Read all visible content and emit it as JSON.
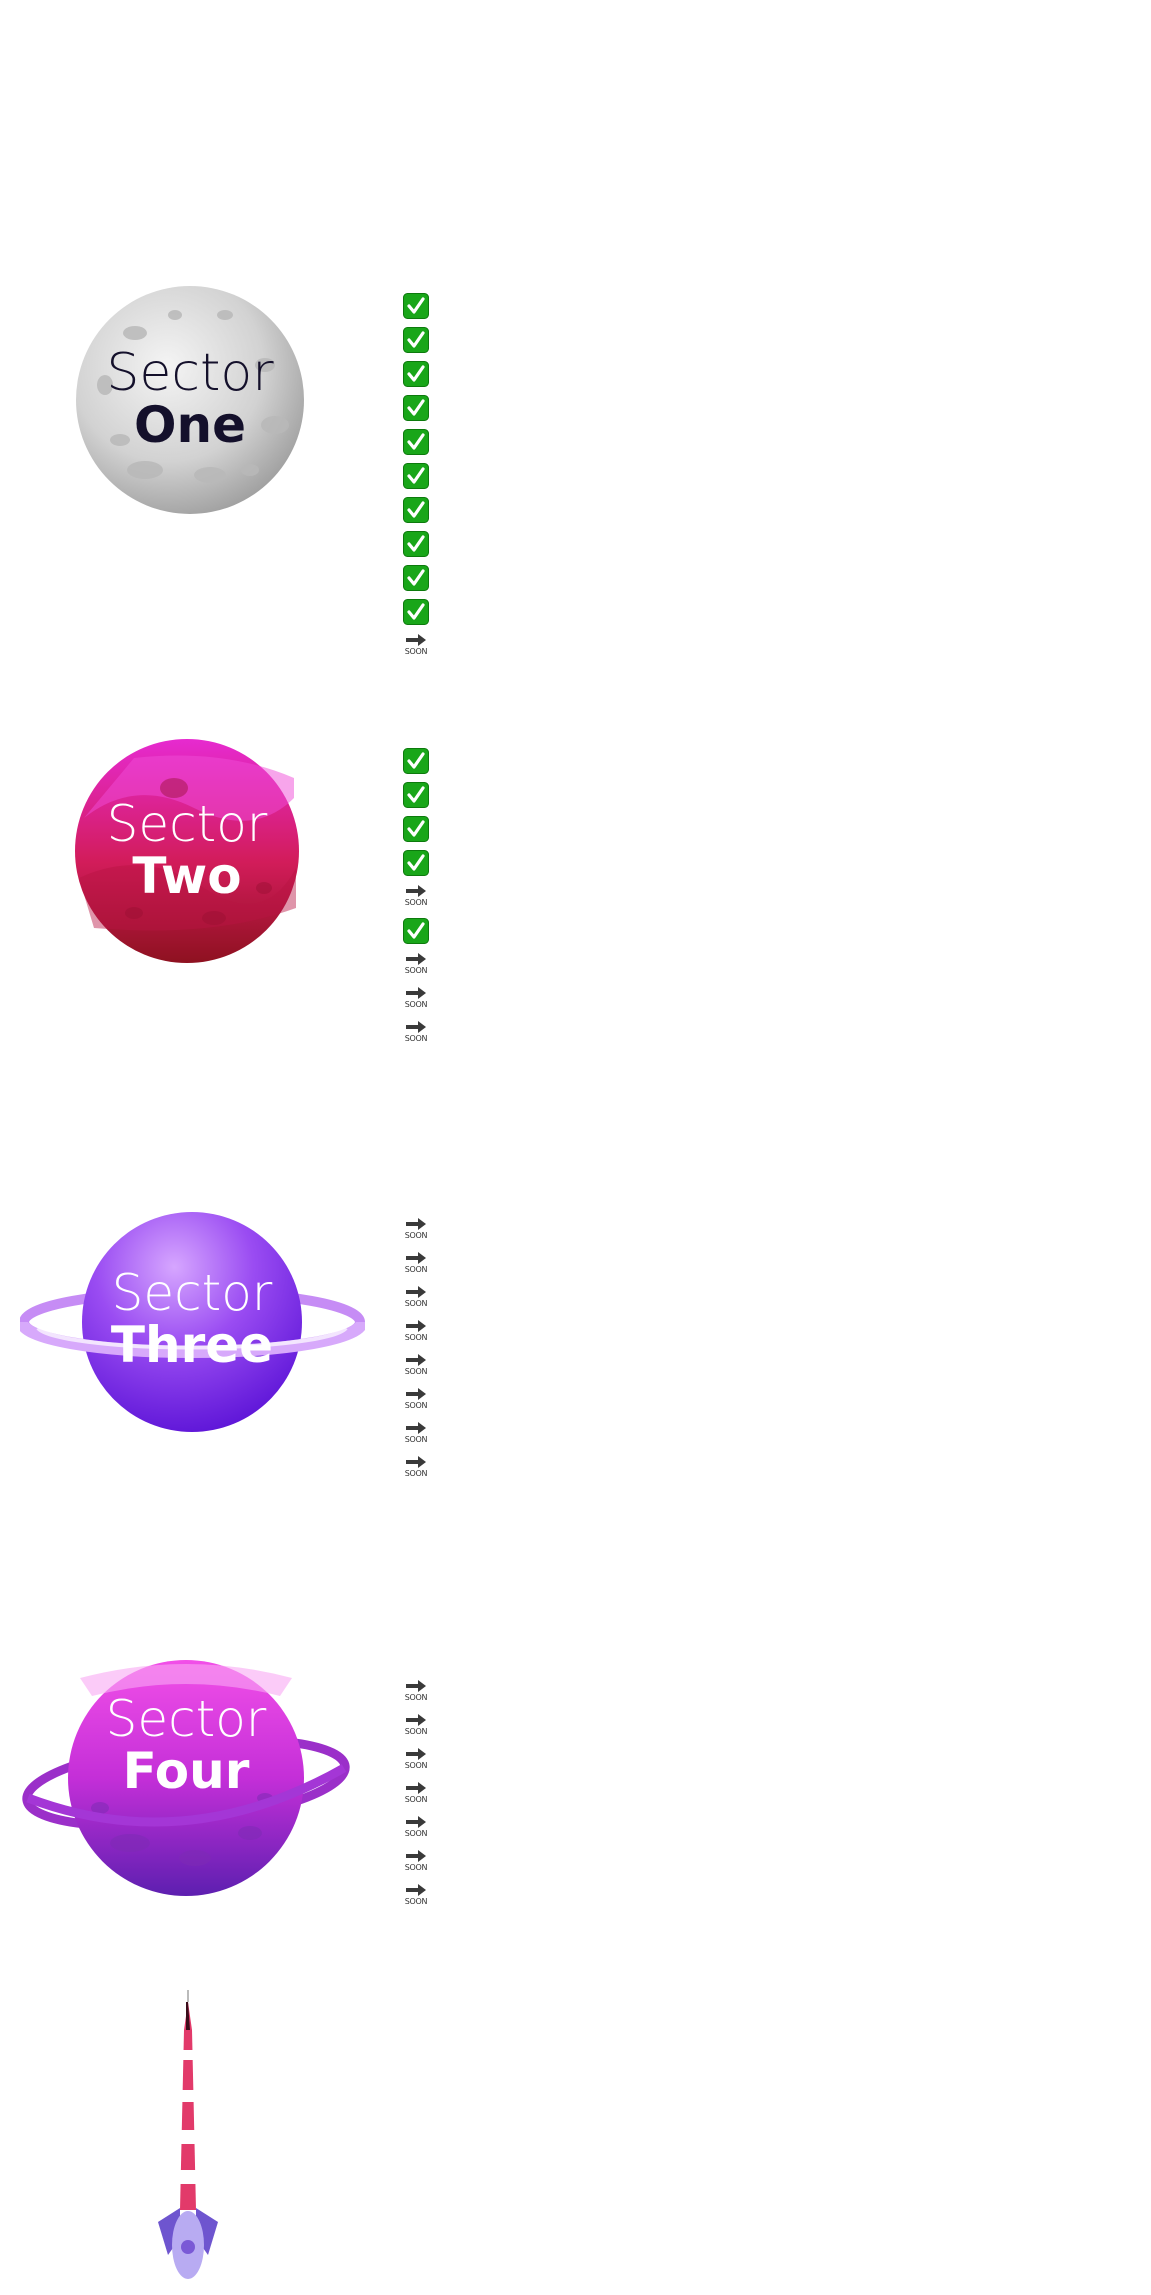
{
  "colors": {
    "check_bg": "#19a619",
    "arrow": "#3a3a3a",
    "sector_one_text": "#14102b",
    "sector_text_light": "#ffffff"
  },
  "sectors": [
    {
      "title_line1": "Sector",
      "title_line2": "One",
      "planet": "grey-moon",
      "steps": [
        "done",
        "done",
        "done",
        "done",
        "done",
        "done",
        "done",
        "done",
        "done",
        "done",
        "soon"
      ]
    },
    {
      "title_line1": "Sector",
      "title_line2": "Two",
      "planet": "magenta-planet",
      "steps": [
        "done",
        "done",
        "done",
        "done",
        "soon",
        "done",
        "soon",
        "soon",
        "soon"
      ]
    },
    {
      "title_line1": "Sector",
      "title_line2": "Three",
      "planet": "ringed-purple-planet",
      "steps": [
        "soon",
        "soon",
        "soon",
        "soon",
        "soon",
        "soon",
        "soon",
        "soon"
      ]
    },
    {
      "title_line1": "Sector",
      "title_line2": "Four",
      "planet": "orbit-pink-planet",
      "steps": [
        "soon",
        "soon",
        "soon",
        "soon",
        "soon",
        "soon",
        "soon"
      ]
    }
  ],
  "soon_label": "SOON",
  "rocket": {
    "icon": "rocket-icon"
  }
}
